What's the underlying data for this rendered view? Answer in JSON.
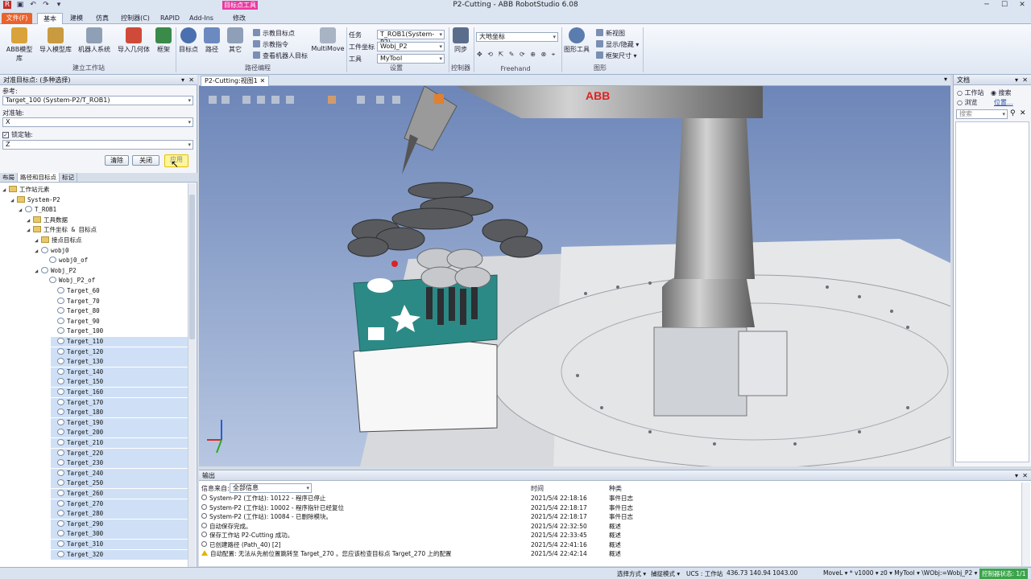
{
  "app": {
    "title": "P2-Cutting - ABB RobotStudio 6.08",
    "context_badge": "目标点工具"
  },
  "tabs": [
    "文件(F)",
    "基本",
    "建模",
    "仿真",
    "控制器(C)",
    "RAPID",
    "Add-Ins",
    "修改"
  ],
  "ribbon": {
    "buttons": [
      "ABB模型库",
      "导入模型库",
      "机器人系统",
      "导入几何体",
      "框架",
      "目标点",
      "路径",
      "其它"
    ],
    "path_items": [
      "示教目标点",
      "示教指令",
      "查看机器人目标"
    ],
    "multimove": "MultiMove",
    "settings": {
      "task_label": "任务",
      "task_value": "T_ROB1(System-P2)",
      "wobj_label": "工件坐标",
      "wobj_value": "Wobj_P2",
      "tool_label": "工具",
      "tool_value": "MyTool"
    },
    "sync": "同步",
    "freehand_combo": "大地坐标",
    "graphics": {
      "tools": "图形工具",
      "new_view": "新视图",
      "show_hide": "显示/隐藏",
      "frame_size": "框架尺寸"
    },
    "groups": [
      "建立工作站",
      "路径编程",
      "设置",
      "控制器",
      "Freehand",
      "图形"
    ]
  },
  "left": {
    "header": "对准目标点: (多种选择)",
    "ref_label": "参考:",
    "ref_value": "Target_100 (System-P2/T_ROB1)",
    "align_label": "对准轴:",
    "align_value": "X",
    "lock_label": "锁定轴:",
    "lock_value": "Z",
    "btn_clear": "清除",
    "btn_close": "关闭",
    "btn_apply": "应用",
    "tree_tabs": [
      "布局",
      "路径和目标点",
      "标记"
    ],
    "tree": [
      {
        "t": "工作站元素",
        "d": 0,
        "k": "folder"
      },
      {
        "t": "System-P2",
        "d": 1,
        "k": "folder"
      },
      {
        "t": "T_ROB1",
        "d": 2,
        "k": "node"
      },
      {
        "t": "工具数据",
        "d": 3,
        "k": "folder"
      },
      {
        "t": "工件坐标 & 目标点",
        "d": 3,
        "k": "folder"
      },
      {
        "t": "接点目标点",
        "d": 4,
        "k": "folder"
      },
      {
        "t": "wobj0",
        "d": 4,
        "k": "node"
      },
      {
        "t": "wobj0_of",
        "d": 5,
        "k": "node"
      },
      {
        "t": "Wobj_P2",
        "d": 4,
        "k": "node"
      },
      {
        "t": "Wobj_P2_of",
        "d": 5,
        "k": "node"
      },
      {
        "t": "Target_60",
        "d": 6,
        "k": "t"
      },
      {
        "t": "Target_70",
        "d": 6,
        "k": "t"
      },
      {
        "t": "Target_80",
        "d": 6,
        "k": "t"
      },
      {
        "t": "Target_90",
        "d": 6,
        "k": "t"
      },
      {
        "t": "Target_100",
        "d": 6,
        "k": "t"
      },
      {
        "t": "Target_110",
        "d": 6,
        "k": "t",
        "s": 1
      },
      {
        "t": "Target_120",
        "d": 6,
        "k": "t",
        "s": 1
      },
      {
        "t": "Target_130",
        "d": 6,
        "k": "t",
        "s": 1
      },
      {
        "t": "Target_140",
        "d": 6,
        "k": "t",
        "s": 1
      },
      {
        "t": "Target_150",
        "d": 6,
        "k": "t",
        "s": 1
      },
      {
        "t": "Target_160",
        "d": 6,
        "k": "t",
        "s": 1
      },
      {
        "t": "Target_170",
        "d": 6,
        "k": "t",
        "s": 1
      },
      {
        "t": "Target_180",
        "d": 6,
        "k": "t",
        "s": 1
      },
      {
        "t": "Target_190",
        "d": 6,
        "k": "t",
        "s": 1
      },
      {
        "t": "Target_200",
        "d": 6,
        "k": "t",
        "s": 1
      },
      {
        "t": "Target_210",
        "d": 6,
        "k": "t",
        "s": 1
      },
      {
        "t": "Target_220",
        "d": 6,
        "k": "t",
        "s": 1
      },
      {
        "t": "Target_230",
        "d": 6,
        "k": "t",
        "s": 1
      },
      {
        "t": "Target_240",
        "d": 6,
        "k": "t",
        "s": 1
      },
      {
        "t": "Target_250",
        "d": 6,
        "k": "t",
        "s": 1
      },
      {
        "t": "Target_260",
        "d": 6,
        "k": "t",
        "s": 1
      },
      {
        "t": "Target_270",
        "d": 6,
        "k": "t",
        "s": 1
      },
      {
        "t": "Target_280",
        "d": 6,
        "k": "t",
        "s": 1
      },
      {
        "t": "Target_290",
        "d": 6,
        "k": "t",
        "s": 1
      },
      {
        "t": "Target_300",
        "d": 6,
        "k": "t",
        "s": 1
      },
      {
        "t": "Target_310",
        "d": 6,
        "k": "t",
        "s": 1
      },
      {
        "t": "Target_320",
        "d": 6,
        "k": "t",
        "s": 1
      }
    ]
  },
  "viewport": {
    "tab": "P2-Cutting:视图1",
    "brand": "ABB"
  },
  "right": {
    "header": "文档",
    "opt_station": "工作站",
    "opt_search": "搜索",
    "opt_browse": "浏览",
    "opt_location": "位置...",
    "search_placeholder": "搜索"
  },
  "output": {
    "header": "输出",
    "filter_label": "信息来自:",
    "filter_value": "全部信息",
    "col_time": "时间",
    "col_kind": "种类",
    "rows": [
      {
        "msg": "System-P2 (工作站): 10122 - 程序已停止",
        "time": "2021/5/4 22:18:16",
        "kind": "事件日志",
        "w": 0
      },
      {
        "msg": "System-P2 (工作站): 10002 - 程序指针已经复位",
        "time": "2021/5/4 22:18:17",
        "kind": "事件日志",
        "w": 0
      },
      {
        "msg": "System-P2 (工作站): 10084 - 已删除模块。",
        "time": "2021/5/4 22:18:17",
        "kind": "事件日志",
        "w": 0
      },
      {
        "msg": "自动保存完成。",
        "time": "2021/5/4 22:32:50",
        "kind": "概述",
        "w": 0
      },
      {
        "msg": "保存工作站 P2-Cutting 成功。",
        "time": "2021/5/4 22:33:45",
        "kind": "概述",
        "w": 0
      },
      {
        "msg": "已创建路径 (Path_40) [2]",
        "time": "2021/5/4 22:41:16",
        "kind": "概述",
        "w": 0
      },
      {
        "msg": "自动配置: 无法从先前位置跳转至 Target_270 。您应该检查目标点 Target_270 上的配置",
        "time": "2021/5/4 22:42:14",
        "kind": "概述",
        "w": 1
      }
    ]
  },
  "status": {
    "select_mode": "选择方式 ▾",
    "snap_mode": "捕捉模式 ▾",
    "ucs": "UCS : 工作站",
    "coords": "436.73   140.94   1043.00",
    "instr": "MoveL ▾ * v1000 ▾ z0 ▾ MyTool ▾ \\WObj:=Wobj_P2 ▾",
    "ctrl_state": "控制器状态: 1/1"
  },
  "colors": {
    "file_tab": "#e9632c",
    "badge": "#e83aa0",
    "ctrl_ok": "#3aa54a"
  }
}
